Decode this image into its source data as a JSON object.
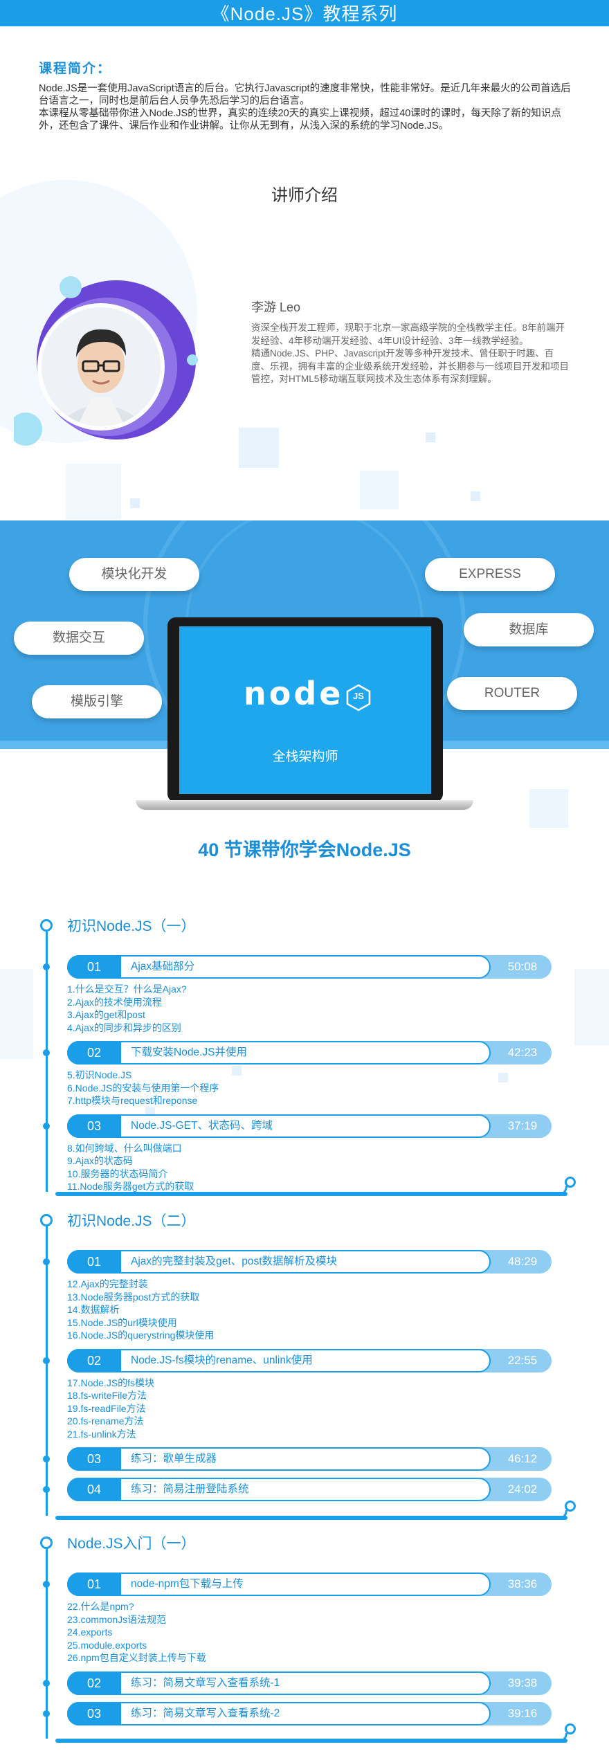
{
  "header": {
    "title": "《Node.JS》教程系列"
  },
  "intro": {
    "title": "课程简介：",
    "paragraphs": [
      "Node.JS是一套使用JavaScript语言的后台。它执行Javascript的速度非常快，性能非常好。是近几年来最火的公司首选后台语言之一，同时也是前后台人员争先恐后学习的后台语言。",
      "本课程从零基础带你进入Node.JS的世界，真实的连续20天的真实上课视频，超过40课时的课时，每天除了新的知识点外，还包含了课件、课后作业和作业讲解。让你从无到有，从浅入深的系统的学习Node.JS。"
    ]
  },
  "teacher": {
    "section_title": "讲师介绍",
    "name": "李游 Leo",
    "bio": [
      "资深全栈开发工程师，现职于北京一家高级学院的全栈教学主任。8年前端开发经验、4年移动端开发经验、4年UI设计经验、3年一线教学经验。",
      "精通Node.JS、PHP、Javascript开发等多种开发技术、曾任职于时趣、百度、乐视，拥有丰富的企业级系统开发经验，并长期参与一线项目开发和项目管控，对HTML5移动端互联网技术及生态体系有深刻理解。"
    ]
  },
  "features": {
    "left": [
      "模块化开发",
      "数据交互",
      "模版引擎"
    ],
    "right": [
      "EXPRESS",
      "数据库",
      "ROUTER"
    ],
    "screen_logo": "node",
    "screen_badge": "JS",
    "screen_caption": "全栈架构师"
  },
  "headline": "40 节课带你学会Node.JS",
  "colors": {
    "accent": "#1a9ee8",
    "band": "#3ea3e4",
    "duration_bg": "#8fcdf2"
  },
  "chapters": [
    {
      "title": "初识Node.JS（一）",
      "lessons": [
        {
          "num": "01",
          "title": "Ajax基础部分",
          "duration": "50:08",
          "topics": [
            "1.什么是交互？什么是Ajax?",
            "2.Ajax的技术使用流程",
            "3.Ajax的get和post",
            "4.Ajax的同步和异步的区别"
          ]
        },
        {
          "num": "02",
          "title": "下载安装Node.JS并使用",
          "duration": "42:23",
          "topics": [
            "5.初识Node.JS",
            "6.Node.JS的安装与使用第一个程序",
            "7.http模块与request和reponse"
          ]
        },
        {
          "num": "03",
          "title": "Node.JS-GET、状态码、跨域",
          "duration": "37:19",
          "topics": [
            "8.如何跨域、什么叫做端口",
            "9.Ajax的状态码",
            "10.服务器的状态码简介",
            "11.Node服务器get方式的获取"
          ]
        }
      ]
    },
    {
      "title": "初识Node.JS（二）",
      "lessons": [
        {
          "num": "01",
          "title": "Ajax的完整封装及get、post数据解析及模块",
          "duration": "48:29",
          "topics": [
            "12.Ajax的完整封装",
            "13.Node服务器post方式的获取",
            "14.数据解析",
            "15.Node.JS的url模块使用",
            "16.Node.JS的querystring模块使用"
          ]
        },
        {
          "num": "02",
          "title": "Node.JS-fs模块的rename、unlink使用",
          "duration": "22:55",
          "topics": [
            "17.Node.JS的fs模块",
            "18.fs-writeFile方法",
            "19.fs-readFile方法",
            "20.fs-rename方法",
            "21.fs-unlink方法"
          ]
        },
        {
          "num": "03",
          "title": "练习：歌单生成器",
          "duration": "46:12",
          "topics": []
        },
        {
          "num": "04",
          "title": "练习：简易注册登陆系统",
          "duration": "24:02",
          "topics": []
        }
      ]
    },
    {
      "title": "Node.JS入门（一）",
      "lessons": [
        {
          "num": "01",
          "title": "node-npm包下载与上传",
          "duration": "38:36",
          "topics": [
            "22.什么是npm?",
            "23.commonJs语法规范",
            "24.exports",
            "25.module.exports",
            "26.npm包自定义封装上传与下载"
          ]
        },
        {
          "num": "02",
          "title": "练习：简易文章写入查看系统-1",
          "duration": "39:38",
          "topics": []
        },
        {
          "num": "03",
          "title": "练习：简易文章写入查看系统-2",
          "duration": "39:16",
          "topics": []
        }
      ]
    }
  ]
}
